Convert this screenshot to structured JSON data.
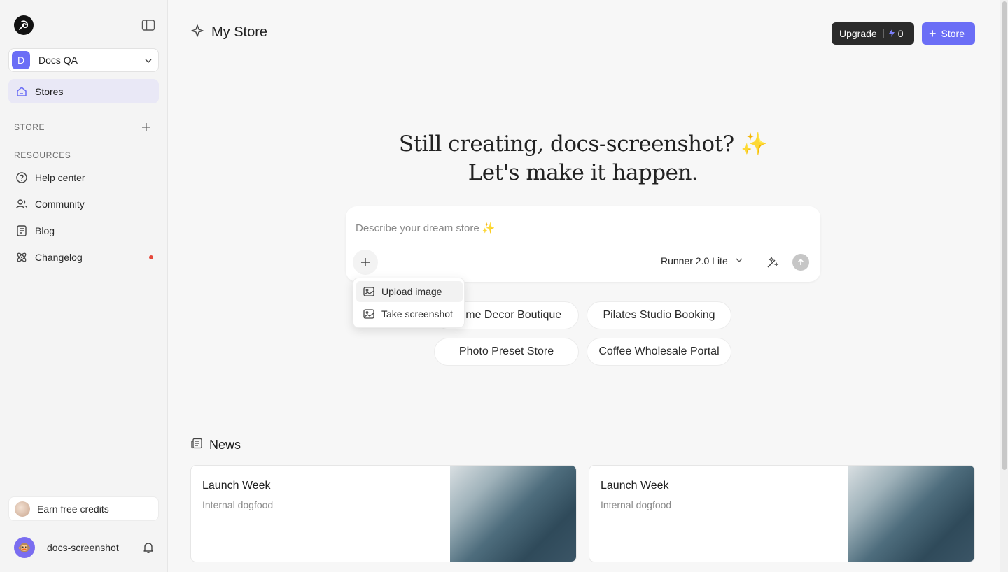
{
  "sidebar": {
    "workspace": {
      "initial": "D",
      "name": "Docs QA"
    },
    "nav_stores": "Stores",
    "store_section": "STORE",
    "resources_section": "RESOURCES",
    "resources": [
      {
        "label": "Help center",
        "icon": "help-circle-icon"
      },
      {
        "label": "Community",
        "icon": "users-icon"
      },
      {
        "label": "Blog",
        "icon": "document-icon"
      },
      {
        "label": "Changelog",
        "icon": "atom-icon"
      }
    ],
    "earn": "Earn free credits",
    "user": {
      "name": "docs-screenshot",
      "avatar": "🐵"
    }
  },
  "header": {
    "title": "My Store",
    "upgrade_label": "Upgrade",
    "credits": "0",
    "store_button": "Store"
  },
  "hero": {
    "line1": "Still creating, docs-screenshot? ✨",
    "line2": "Let's make it happen."
  },
  "prompt": {
    "placeholder": "Describe your dream store ✨",
    "model": "Runner 2.0 Lite"
  },
  "attach_menu": {
    "items": [
      "Upload image",
      "Take screenshot"
    ]
  },
  "suggestions": [
    "Home Decor Boutique",
    "Pilates Studio Booking",
    "Photo Preset Store",
    "Coffee Wholesale Portal"
  ],
  "news": {
    "title": "News",
    "cards": [
      {
        "title": "Launch Week",
        "subtitle": "Internal dogfood"
      },
      {
        "title": "Launch Week",
        "subtitle": "Internal dogfood"
      }
    ]
  },
  "colors": {
    "accent": "#6b6ef6",
    "dark": "#2b2b2b",
    "alert": "#e5483b"
  }
}
